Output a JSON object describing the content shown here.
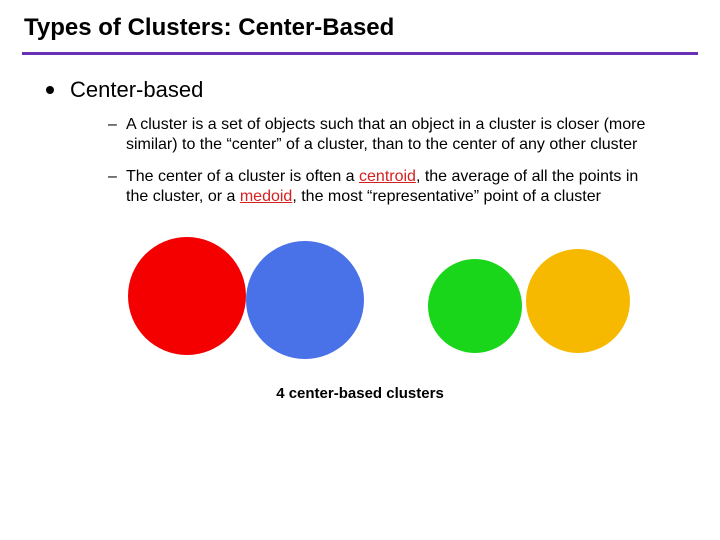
{
  "title": "Types of Clusters: Center-Based",
  "heading": "Center-based",
  "sub1_pre": " A cluster is a set of objects such that an object in a cluster is closer (more similar) to the “center” of a cluster, than to the center of any other cluster",
  "sub2_a": "The center of a cluster is often a ",
  "sub2_term1": "centroid",
  "sub2_b": ", the average of all the points in the cluster, or a ",
  "sub2_term2": "medoid",
  "sub2_c": ", the most “representative” point of a cluster",
  "caption": "4 center-based clusters",
  "dash": "–"
}
